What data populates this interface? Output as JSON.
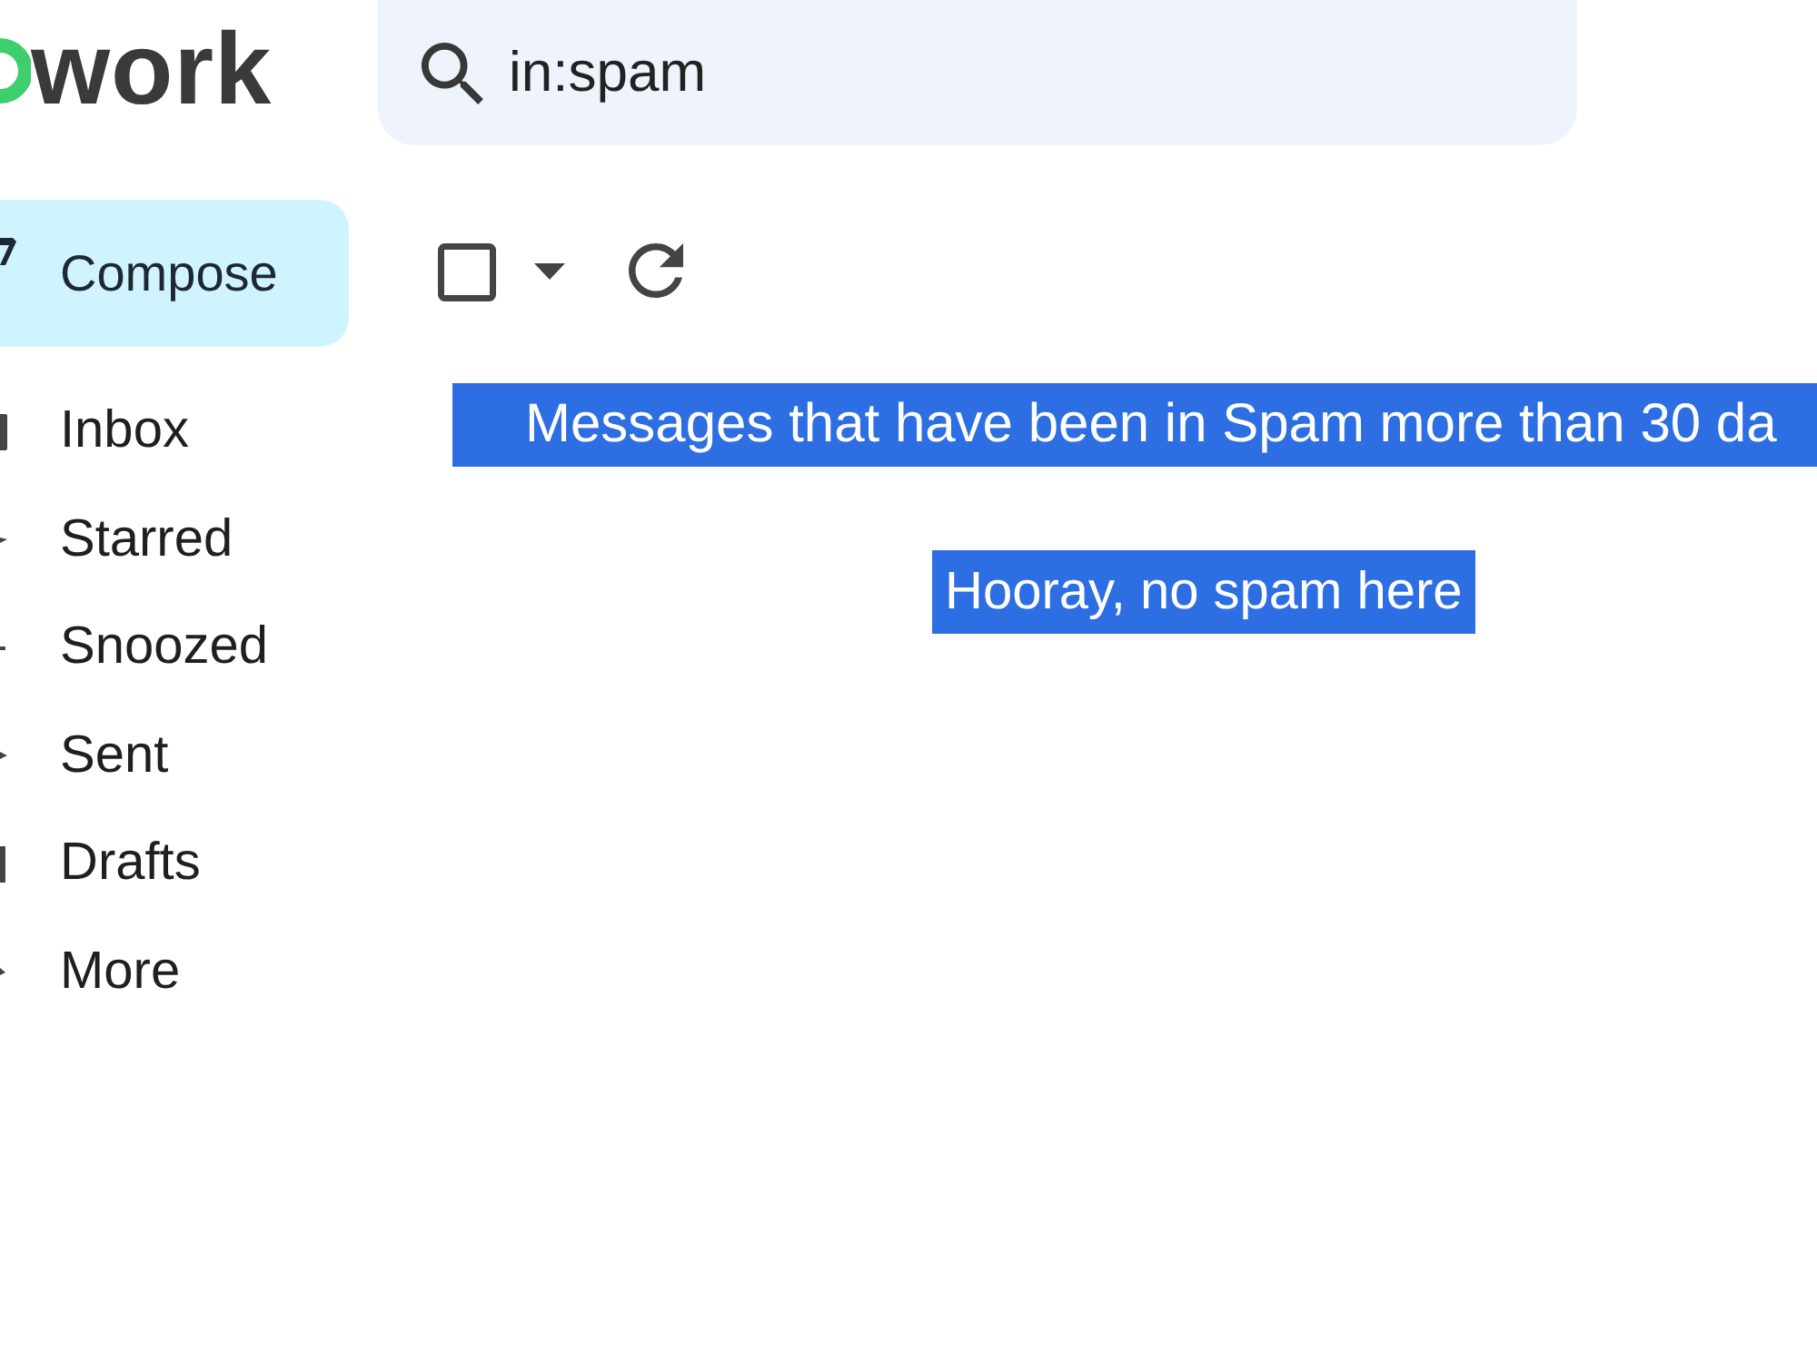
{
  "logo": {
    "text": "work"
  },
  "search": {
    "value": "in:spam"
  },
  "compose": {
    "label": "Compose"
  },
  "nav": [
    {
      "label": "Inbox",
      "selected": false
    },
    {
      "label": "Starred",
      "selected": false
    },
    {
      "label": "Snoozed",
      "selected": false
    },
    {
      "label": "Sent",
      "selected": false
    },
    {
      "label": "Drafts",
      "selected": false
    },
    {
      "label": "More",
      "selected": false
    }
  ],
  "toolbar": {
    "select_all": {
      "checked": false
    }
  },
  "spam_notice": "Messages that have been in Spam more than 30 da",
  "empty_state": "Hooray, no spam here"
}
